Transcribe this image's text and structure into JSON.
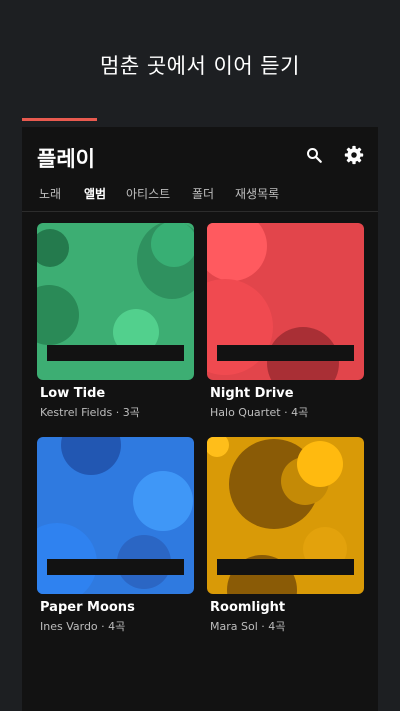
{
  "promo": {
    "headline": "멈춘 곳에서 이어 듣기"
  },
  "colors": {
    "accent": "#e85a4f",
    "background": "#1d1f22",
    "surface": "#121212"
  },
  "app": {
    "title": "플레이",
    "icons": [
      "search-icon",
      "gear-icon"
    ],
    "tabs": [
      {
        "label": "노래",
        "active": false
      },
      {
        "label": "앨범",
        "active": true
      },
      {
        "label": "아티스트",
        "active": false
      },
      {
        "label": "폴더",
        "active": false
      },
      {
        "label": "재생목록",
        "active": false
      }
    ]
  },
  "albums": [
    {
      "title": "Low Tide",
      "meta": "Kestrel Fields · 3곡",
      "color": "#3dae73"
    },
    {
      "title": "Night Drive",
      "meta": "Halo Quartet · 4곡",
      "color": "#e2454b"
    },
    {
      "title": "Paper Moons",
      "meta": "Ines Vardo · 4곡",
      "color": "#2f7ae0"
    },
    {
      "title": "Roomlight",
      "meta": "Mara Sol · 4곡",
      "color": "#d99a07"
    }
  ]
}
